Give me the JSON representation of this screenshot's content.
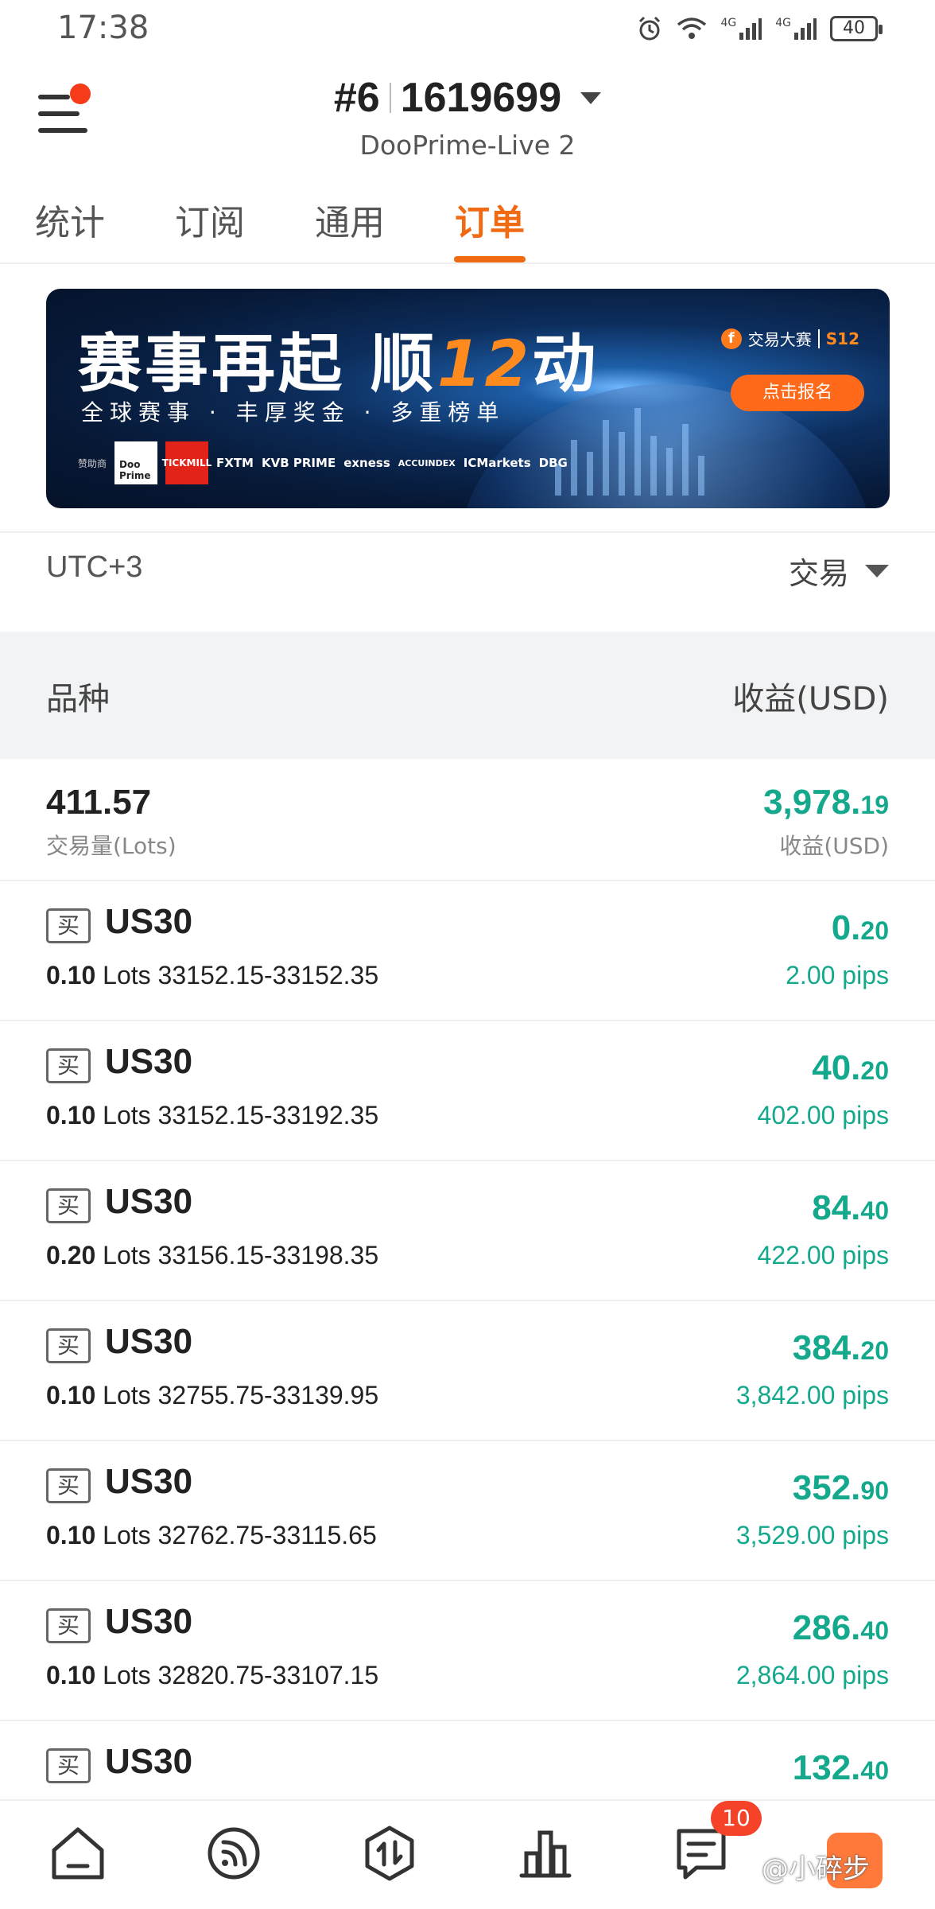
{
  "status_bar": {
    "time": "17:38",
    "network_1": "4G",
    "network_2": "4G",
    "battery": "40"
  },
  "header": {
    "account_prefix": "#6",
    "account_id": "1619699",
    "server": "DooPrime-Live 2",
    "menu_badge_color": "#f53b1a"
  },
  "tabs": [
    {
      "label": "统计",
      "active": false
    },
    {
      "label": "订阅",
      "active": false
    },
    {
      "label": "通用",
      "active": false
    },
    {
      "label": "订单",
      "active": true
    }
  ],
  "banner": {
    "title_part1": "赛事再起 顺",
    "title_highlight": "12",
    "title_part2": "动",
    "subtitle": "全球赛事 · 丰厚奖金 · 多重榜单",
    "brand": "交易大赛",
    "brand_season": "S12",
    "cta": "点击报名",
    "sponsor_label": "赞助商",
    "sponsors": [
      "Doo Prime",
      "TICKMILL",
      "FXTM",
      "KVB PRIME",
      "exness",
      "ACCUINDEX",
      "ICMarkets",
      "DBG"
    ]
  },
  "filter": {
    "timezone": "UTC+3",
    "type": "交易"
  },
  "columns": {
    "symbol": "品种",
    "profit": "收益(USD)"
  },
  "summary": {
    "lots": "411.57",
    "lots_label": "交易量(Lots)",
    "profit_int": "3,978.",
    "profit_dec": "19",
    "profit_label": "收益(USD)"
  },
  "orders": [
    {
      "side": "买",
      "symbol": "US30",
      "lots": "0.10",
      "lots_unit": "Lots",
      "range": "33152.15-33152.35",
      "pnl_int": "0.",
      "pnl_dec": "20",
      "pips": "2.00 pips"
    },
    {
      "side": "买",
      "symbol": "US30",
      "lots": "0.10",
      "lots_unit": "Lots",
      "range": "33152.15-33192.35",
      "pnl_int": "40.",
      "pnl_dec": "20",
      "pips": "402.00 pips"
    },
    {
      "side": "买",
      "symbol": "US30",
      "lots": "0.20",
      "lots_unit": "Lots",
      "range": "33156.15-33198.35",
      "pnl_int": "84.",
      "pnl_dec": "40",
      "pips": "422.00 pips"
    },
    {
      "side": "买",
      "symbol": "US30",
      "lots": "0.10",
      "lots_unit": "Lots",
      "range": "32755.75-33139.95",
      "pnl_int": "384.",
      "pnl_dec": "20",
      "pips": "3,842.00 pips"
    },
    {
      "side": "买",
      "symbol": "US30",
      "lots": "0.10",
      "lots_unit": "Lots",
      "range": "32762.75-33115.65",
      "pnl_int": "352.",
      "pnl_dec": "90",
      "pips": "3,529.00 pips"
    },
    {
      "side": "买",
      "symbol": "US30",
      "lots": "0.10",
      "lots_unit": "Lots",
      "range": "32820.75-33107.15",
      "pnl_int": "286.",
      "pnl_dec": "40",
      "pips": "2,864.00 pips"
    },
    {
      "side": "买",
      "symbol": "US30",
      "lots": "",
      "lots_unit": "",
      "range": "",
      "pnl_int": "132.",
      "pnl_dec": "40",
      "pips": ""
    }
  ],
  "bottom_nav": {
    "items": [
      "home-icon",
      "signal-icon",
      "trade-icon",
      "chart-icon",
      "messages-icon",
      "profile-icon"
    ],
    "messages_badge": "10",
    "watermark": "@小碎步"
  },
  "colors": {
    "accent": "#f06a14",
    "profit": "#14a98c",
    "badge": "#f5432a"
  }
}
